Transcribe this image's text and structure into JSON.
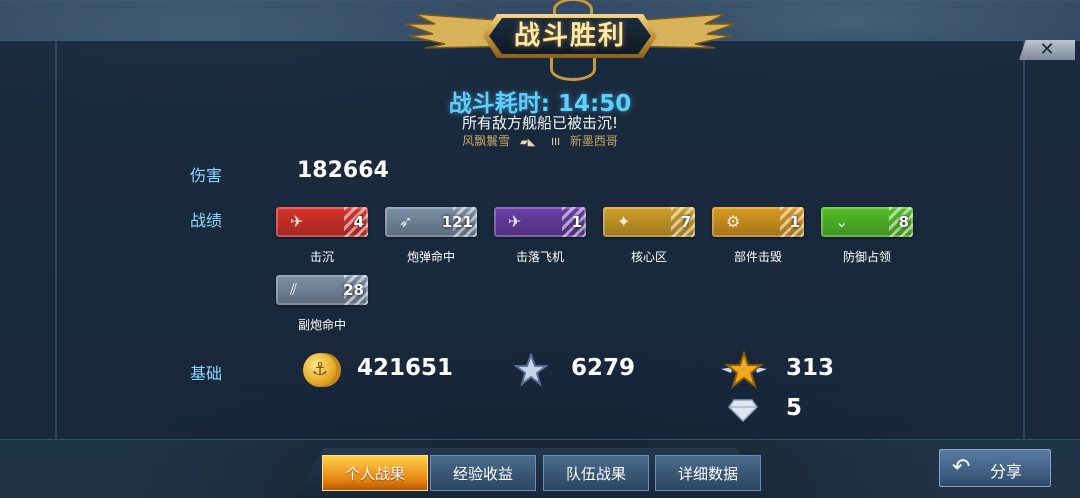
{
  "header": {
    "title": "战斗胜利",
    "close_icon": "close-icon"
  },
  "summary": {
    "time_label": "战斗耗时: 14:50",
    "result_text": "所有敌方舰船已被击沉!",
    "player_name": "风飘鬟雪",
    "rank_mark": "III",
    "map_name": "新墨西哥"
  },
  "stats": {
    "damage_label": "伤害",
    "damage_value": "182664",
    "record_label": "战绩",
    "base_label": "基础"
  },
  "achievements": [
    {
      "label": "击沉",
      "count": "4",
      "color": "#d9332c",
      "icon": "sunk-ship-icon"
    },
    {
      "label": "炮弹命中",
      "count": "121",
      "color": "#7b8fa6",
      "icon": "shell-icon"
    },
    {
      "label": "击落飞机",
      "count": "1",
      "color": "#6a3fa8",
      "icon": "plane-icon"
    },
    {
      "label": "核心区",
      "count": "7",
      "color": "#d2a02a",
      "icon": "citadel-icon"
    },
    {
      "label": "部件击毁",
      "count": "1",
      "color": "#d99a20",
      "icon": "gear-icon"
    },
    {
      "label": "防御占领",
      "count": "8",
      "color": "#55c02a",
      "icon": "chevron-icon"
    },
    {
      "label": "副炮命中",
      "count": "28",
      "color": "#7b8fa6",
      "icon": "secondary-gun-icon"
    }
  ],
  "resources": {
    "credits": "421651",
    "experience": "6279",
    "commander_xp": "313",
    "diamonds": "5"
  },
  "tabs": [
    "个人战果",
    "经验收益",
    "队伍战果",
    "详细数据"
  ],
  "share": {
    "label": "分享",
    "icon": "share-icon"
  }
}
